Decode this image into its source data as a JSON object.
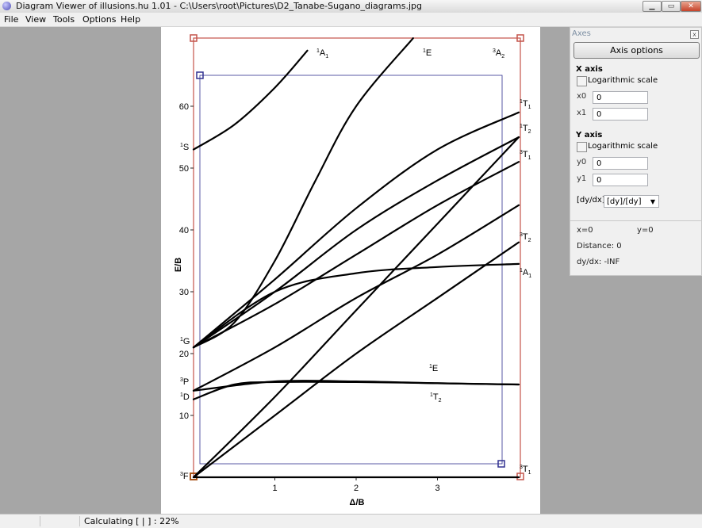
{
  "window": {
    "title": "Diagram Viewer of illusions.hu 1.01 - C:\\Users\\root\\Pictures\\D2_Tanabe-Sugano_diagrams.jpg",
    "controls": {
      "minimize": "▁",
      "maximize": "▭",
      "close": "✕"
    }
  },
  "menu": [
    "File",
    "View",
    "Tools",
    "Options",
    "Help"
  ],
  "diagram": {
    "y_axis_title": "E/B",
    "x_axis_title": "Δ/B",
    "y_ticks": [
      "10",
      "20",
      "30",
      "40",
      "50",
      "60"
    ],
    "x_ticks": [
      "1",
      "2",
      "3"
    ],
    "left_terms": [
      "1S",
      "1G",
      "3P",
      "1D",
      "3F"
    ],
    "right_terms": [
      "1T1",
      "1T2",
      "3T1",
      "3T2",
      "1A1",
      "3T1"
    ],
    "top_terms": [
      "1A1",
      "1E",
      "3A2"
    ],
    "mid_terms": [
      "1E",
      "1T2"
    ],
    "chart_data": {
      "type": "line",
      "title": "",
      "xlabel": "Δ/B",
      "ylabel": "E/B",
      "xlim": [
        0,
        4
      ],
      "ylim": [
        0,
        68
      ],
      "series": [
        {
          "x": [
            0,
            0.5,
            1.0,
            1.4
          ],
          "y": [
            53,
            57,
            63,
            69
          ]
        },
        {
          "x": [
            0,
            1.0,
            2.0,
            3.0,
            4.0
          ],
          "y": [
            21,
            32,
            43.5,
            53,
            59
          ]
        },
        {
          "x": [
            0,
            1.0,
            2.0,
            3.0,
            4.0
          ],
          "y": [
            21,
            30,
            40,
            48,
            55
          ]
        },
        {
          "x": [
            0,
            1.0,
            2.0,
            3.0,
            4.0
          ],
          "y": [
            21,
            28,
            36,
            44,
            51
          ]
        },
        {
          "x": [
            0,
            1.0,
            2.0,
            3.0,
            4.0
          ],
          "y": [
            21,
            30,
            33,
            34,
            34.5
          ]
        },
        {
          "x": [
            0,
            0.5,
            1.0,
            1.5,
            2.0,
            2.7
          ],
          "y": [
            21,
            25,
            35,
            48,
            60,
            71
          ]
        },
        {
          "x": [
            0,
            1.0,
            2.0,
            3.0,
            4.0
          ],
          "y": [
            14,
            21,
            29,
            36,
            44
          ]
        },
        {
          "x": [
            0,
            1.0,
            2.0,
            3.0,
            4.0
          ],
          "y": [
            0,
            13,
            27,
            41,
            55
          ]
        },
        {
          "x": [
            0,
            1.0,
            2.0,
            3.0,
            4.0
          ],
          "y": [
            0,
            10,
            20,
            29,
            38
          ]
        },
        {
          "x": [
            0,
            1.0,
            2.0,
            3.0,
            4.0
          ],
          "y": [
            14,
            15.5,
            15.5,
            15.2,
            15
          ]
        },
        {
          "x": [
            0,
            0.5,
            1.0,
            2.0,
            3.0,
            4.0
          ],
          "y": [
            12.6,
            15,
            15.4,
            15.4,
            15.2,
            15
          ]
        },
        {
          "x": [
            0,
            1.0,
            2.0,
            3.0,
            4.0
          ],
          "y": [
            0,
            0,
            0,
            0,
            0
          ]
        }
      ]
    }
  },
  "axes_panel": {
    "title": "Axes",
    "close_icon": "x",
    "axis_options_button": "Axis options",
    "x_section": "X axis",
    "x_log_label": "Logarithmic scale",
    "x0_label": "x0",
    "x0_value": "0",
    "x1_label": "x1",
    "x1_value": "0",
    "y_section": "Y axis",
    "y_log_label": "Logarithmic scale",
    "y0_label": "y0",
    "y0_value": "0",
    "y1_label": "y1",
    "y1_value": "0",
    "dyd_label": "[dy/dx]",
    "dyd_value": "[dy]/[dy]",
    "x_readout": "x=0",
    "y_readout": "y=0",
    "distance": "Distance: 0",
    "slope": "dy/dx:  -INF"
  },
  "status": {
    "text": "Calculating [ | ] : 22%"
  }
}
